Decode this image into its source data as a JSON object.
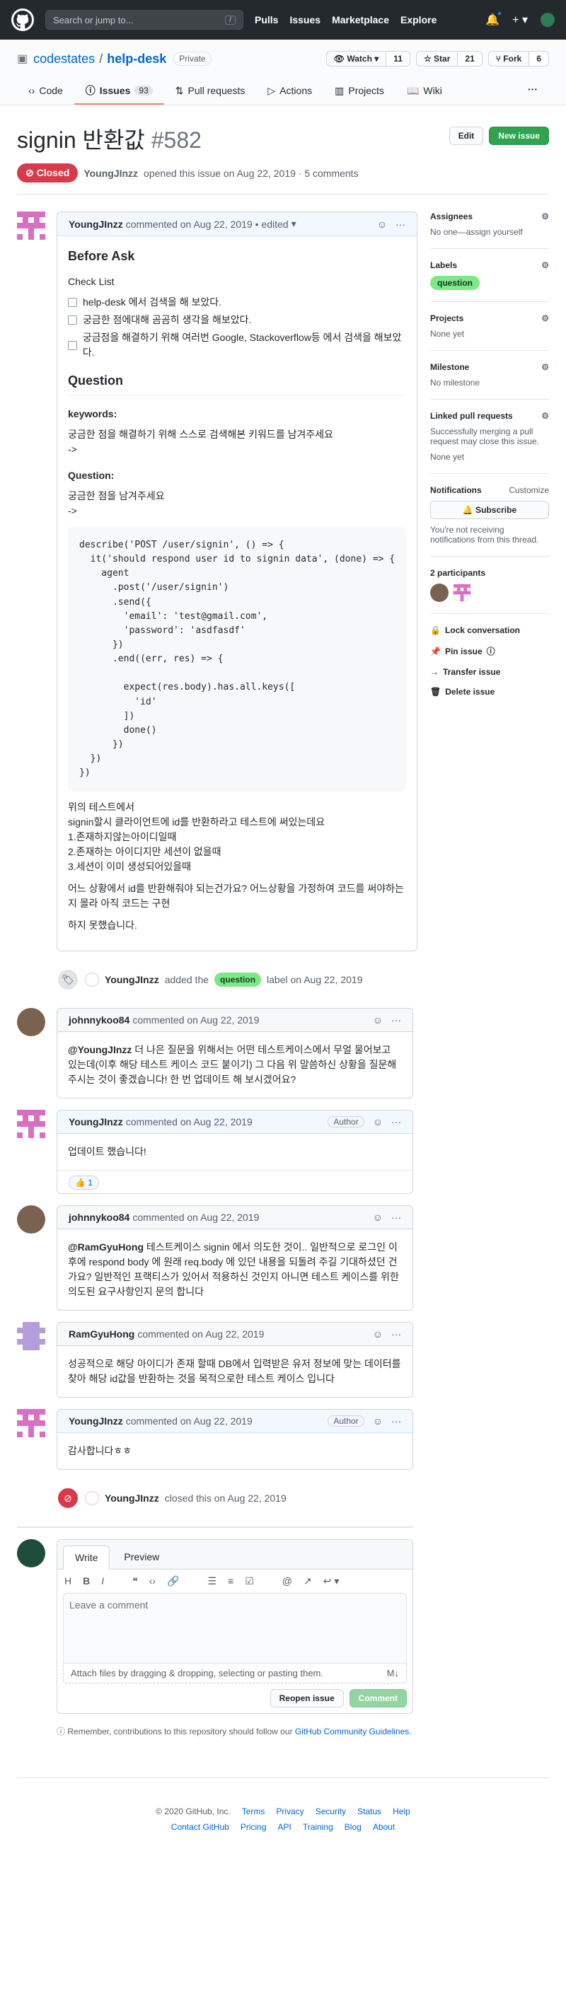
{
  "header": {
    "search_placeholder": "Search or jump to...",
    "slash_hint": "/",
    "nav": [
      "Pulls",
      "Issues",
      "Marketplace",
      "Explore"
    ]
  },
  "repo": {
    "owner": "codestates",
    "name": "help-desk",
    "visibility": "Private",
    "watch_label": "Watch",
    "watch_count": "11",
    "star_label": "Star",
    "star_count": "21",
    "fork_label": "Fork",
    "fork_count": "6",
    "tabs": [
      {
        "label": "Code",
        "icon": "code-icon"
      },
      {
        "label": "Issues",
        "count": "93",
        "icon": "issue-icon"
      },
      {
        "label": "Pull requests",
        "icon": "pull-request-icon"
      },
      {
        "label": "Actions",
        "icon": "play-icon"
      },
      {
        "label": "Projects",
        "icon": "project-icon"
      },
      {
        "label": "Wiki",
        "icon": "book-icon"
      }
    ],
    "more": "···"
  },
  "issue": {
    "title": "signin 반환값",
    "number": "#582",
    "edit_label": "Edit",
    "new_issue_label": "New issue",
    "state": "Closed",
    "author": "YoungJInzz",
    "opened_text": "opened this issue on Aug 22, 2019 · 5 comments"
  },
  "first_comment": {
    "author": "YoungJInzz",
    "meta": "commented on Aug 22, 2019 • edited",
    "h_before": "Before Ask",
    "h_checklist": "Check List",
    "tasks": [
      "help-desk 에서 검색을 해 보았다.",
      "궁금한 점에대해 곰곰히 생각을 해보았다.",
      "궁금점을 해결하기 위해 여러번 Google, Stackoverflow등 에서 검색을 해보았다."
    ],
    "h_question": "Question",
    "keywords_label": "keywords:",
    "keywords_text": "궁금한 점을 해결하기 위해 스스로 검색해본 키워드를 남겨주세요",
    "keywords_arrow": "->",
    "question_label": "Question:",
    "question_text": "궁금한 점을 남겨주세요",
    "question_arrow": "->",
    "code": "describe('POST /user/signin', () => {\n  it('should respond user id to signin data', (done) => {\n    agent\n      .post('/user/signin')\n      .send({\n        'email': 'test@gmail.com',\n        'password': 'asdfasdf'\n      })\n      .end((err, res) => {\n\n        expect(res.body).has.all.keys([\n          'id'\n        ])\n        done()\n      })\n  })\n})",
    "para1": [
      "위의 테스트에서",
      "signin할시 클라이언트에 id를 반환하라고 테스트에 써있는데요",
      "1.존재하지않는아이디일때",
      "2.존재하는 아이디지만 세션이 없을때",
      "3.세션이 이미 생성되어있을때"
    ],
    "para2": "어느 상황에서 id를 반환해줘야 되는건가요? 어느상황을 가정하여 코드를 써야하는지 몰라 아직 코드는 구현",
    "para3": "하지 못했습니다."
  },
  "label_event": {
    "actor": "YoungJInzz",
    "text_before": "added the",
    "label": "question",
    "text_after": "label on Aug 22, 2019"
  },
  "comments": [
    {
      "author": "johnnykoo84",
      "meta": "commented on Aug 22, 2019",
      "mention": "@YoungJInzz",
      "body": "더 나은 질문을 위해서는 어떤 테스트케이스에서 무얼 물어보고 있는데(이후 해당 테스트 케이스 코드 붙이기) 그 다음 위 말씀하신 상황을 질문해 주시는 것이 좋겠습니다! 한 번 업데이트 해 보시겠어요?"
    },
    {
      "author": "YoungJInzz",
      "meta": "commented on Aug 22, 2019",
      "badge": "Author",
      "body": "업데이트 했습니다!",
      "reaction": "👍 1"
    },
    {
      "author": "johnnykoo84",
      "meta": "commented on Aug 22, 2019",
      "mention": "@RamGyuHong",
      "body": "테스트케이스 signin 에서 의도한 것이.. 일반적으로 로그인 이후에 respond body 에 원래 req.body 에 있던 내용을 되돌려 주길 기대하셨던 건가요? 일반적인 프랙티스가 있어서 적용하신 것인지 아니면 테스트 케이스를 위한 의도된 요구사항인지 문의 합니다"
    },
    {
      "author": "RamGyuHong",
      "meta": "commented on Aug 22, 2019",
      "body": "성공적으로 해당 아이디가 존재 할때 DB에서 입력받은 유저 정보에 맞는 데이터를 찾아 해당 id값을 반환하는 것을 목적으로한 테스트 케이스 입니다"
    },
    {
      "author": "YoungJInzz",
      "meta": "commented on Aug 22, 2019",
      "badge": "Author",
      "body": "감사합니다ㅎㅎ"
    }
  ],
  "close_event": {
    "actor": "YoungJInzz",
    "text": "closed this on Aug 22, 2019"
  },
  "new_comment": {
    "tab_write": "Write",
    "tab_preview": "Preview",
    "placeholder": "Leave a comment",
    "attach_text": "Attach files by dragging & dropping, selecting or pasting them.",
    "reopen_label": "Reopen issue",
    "comment_label": "Comment",
    "note_text": "Remember, contributions to this repository should follow our",
    "note_link": "GitHub Community Guidelines."
  },
  "sidebar": {
    "assignees_title": "Assignees",
    "assignees_value": "No one—assign yourself",
    "labels_title": "Labels",
    "labels_value": "question",
    "projects_title": "Projects",
    "projects_value": "None yet",
    "milestone_title": "Milestone",
    "milestone_value": "No milestone",
    "linked_title": "Linked pull requests",
    "linked_desc": "Successfully merging a pull request may close this issue.",
    "linked_value": "None yet",
    "notifications_title": "Notifications",
    "customize_label": "Customize",
    "subscribe_label": "Subscribe",
    "notif_desc": "You're not receiving notifications from this thread.",
    "participants_title": "2 participants",
    "lock_label": "Lock conversation",
    "pin_label": "Pin issue",
    "transfer_label": "Transfer issue",
    "delete_label": "Delete issue"
  },
  "footer": {
    "copyright": "© 2020 GitHub, Inc.",
    "row1": [
      "Terms",
      "Privacy",
      "Security",
      "Status",
      "Help"
    ],
    "row2": [
      "Contact GitHub",
      "Pricing",
      "API",
      "Training",
      "Blog",
      "About"
    ]
  },
  "colors": {
    "header_bg": "#24292e",
    "closed_red": "#d73a49",
    "label_green": "#7ee787",
    "link_blue": "#0366d6",
    "button_green": "#2ea44f"
  }
}
